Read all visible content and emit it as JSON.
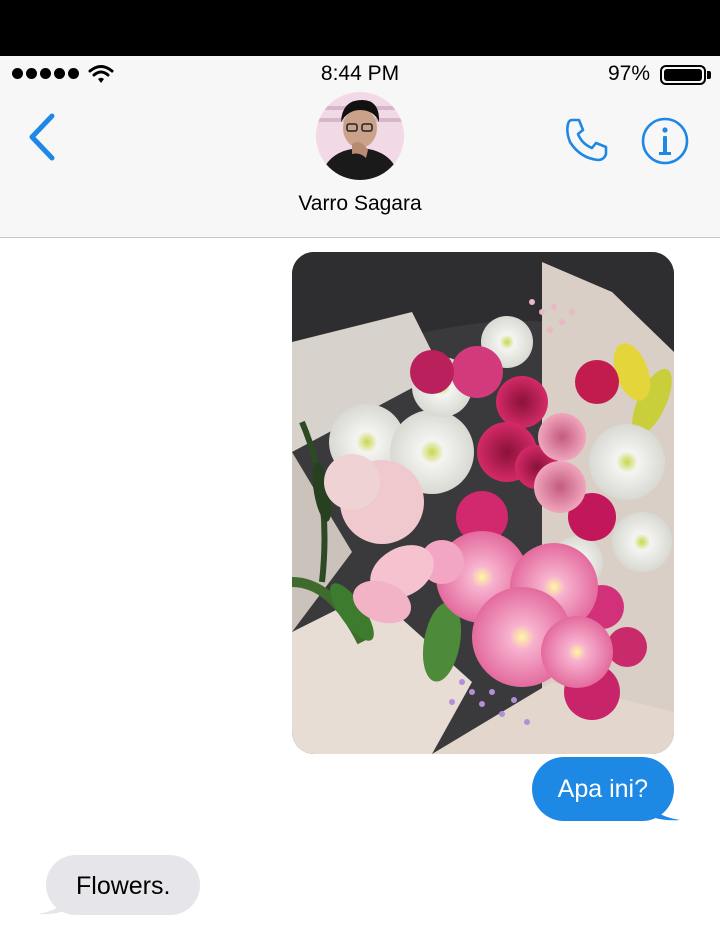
{
  "status_bar": {
    "time": "8:44 PM",
    "battery_percent": "97%",
    "signal_dots": 5,
    "signal_icon": "signal-dots-icon",
    "wifi_icon": "wifi-icon",
    "battery_icon": "battery-icon"
  },
  "header": {
    "contact_name": "Varro Sagara",
    "back_icon": "chevron-left-icon",
    "call_icon": "phone-icon",
    "info_icon": "info-icon",
    "accent_color": "#1e88e5"
  },
  "messages": [
    {
      "direction": "outgoing",
      "type": "image",
      "subject": "flower bouquet photo"
    },
    {
      "direction": "outgoing",
      "type": "text",
      "text": "Apa ini?"
    },
    {
      "direction": "incoming",
      "type": "text",
      "text": "Flowers."
    }
  ],
  "colors": {
    "outgoing_bubble": "#1e88e5",
    "incoming_bubble": "#e5e5ea",
    "header_bg": "#f7f7f7"
  }
}
